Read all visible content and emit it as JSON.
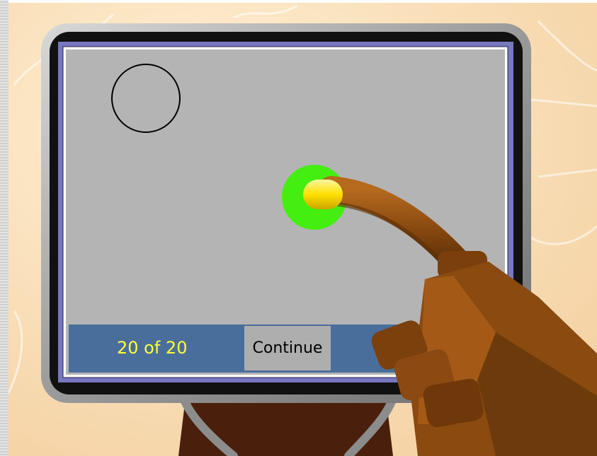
{
  "status": {
    "progress": "20 of 20",
    "continue_label": "Continue"
  },
  "colors": {
    "background": "#f9dfbb",
    "bezel": "#9a9a9a",
    "frame": "#7878c0",
    "screen": "#b4b4b4",
    "status_bar": "#4a6e9b",
    "progress_text": "#ffff33",
    "button": "#aeaeae",
    "touch_feedback": "#44ee11",
    "fingertip": "#ffe000",
    "hand": "#8a4a10"
  },
  "icons": {
    "target": "circle-outline-icon",
    "touch": "touch-feedback-icon",
    "hand": "pointing-hand"
  }
}
